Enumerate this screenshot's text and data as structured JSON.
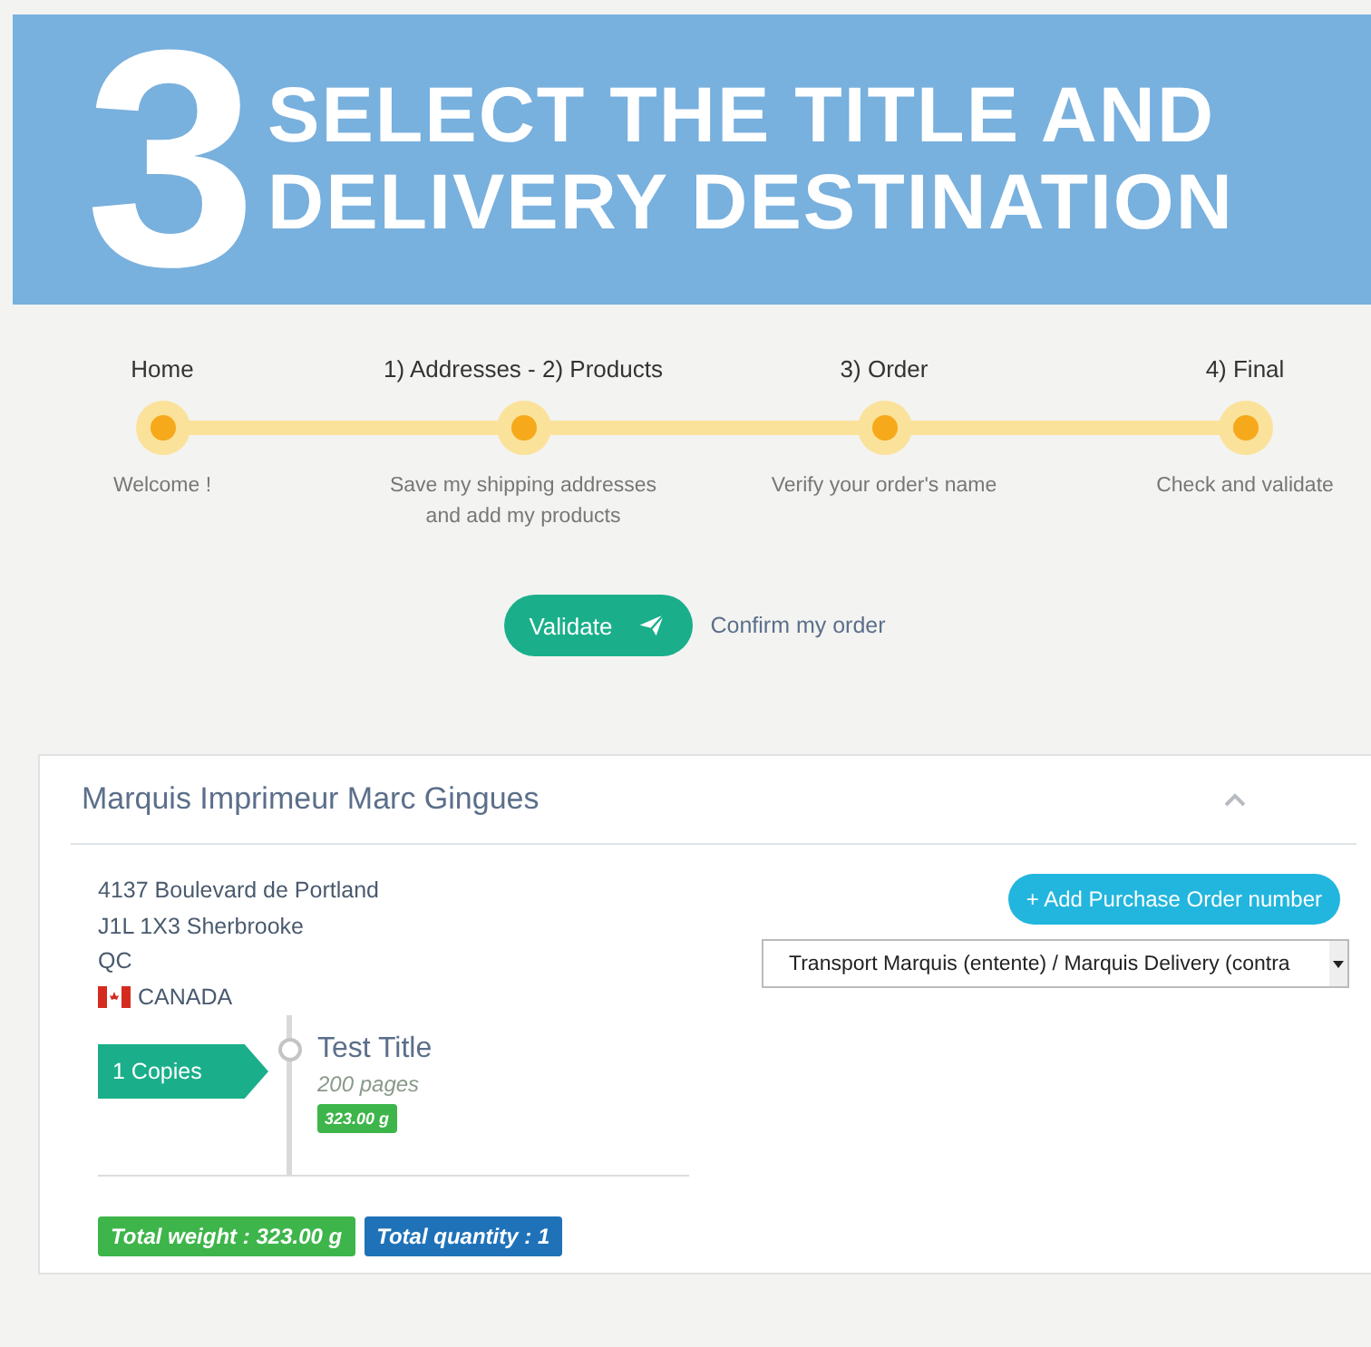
{
  "banner": {
    "number": "3",
    "title_lines": [
      "SELECT THE TITLE AND",
      "DELIVERY DESTINATION"
    ]
  },
  "steps": [
    {
      "label": "Home",
      "description": "Welcome !"
    },
    {
      "label": "1) Addresses - 2) Products",
      "description": "Save my shipping addresses and add my products"
    },
    {
      "label": "3) Order",
      "description": "Verify your order's name"
    },
    {
      "label": "4) Final",
      "description": "Check and validate"
    }
  ],
  "validate": {
    "button": "Validate",
    "text": "Confirm my order"
  },
  "card": {
    "title": "Marquis Imprimeur Marc Gingues",
    "address": [
      "4137 Boulevard de Portland",
      "J1L 1X3 Sherbrooke",
      "QC"
    ],
    "country": "CANADA",
    "po_button": "+ Add Purchase Order number",
    "delivery_select": "Transport Marquis (entente) / Marquis Delivery (contra",
    "items": [
      {
        "copies": "1 Copies",
        "title": "Test Title",
        "pages": "200 pages",
        "weight": "323.00 g"
      }
    ],
    "totals": [
      {
        "text": "Total weight : 323.00 g",
        "color": "#3db54a"
      },
      {
        "text": "Total quantity : 1",
        "color": "#1f72b8"
      }
    ]
  }
}
